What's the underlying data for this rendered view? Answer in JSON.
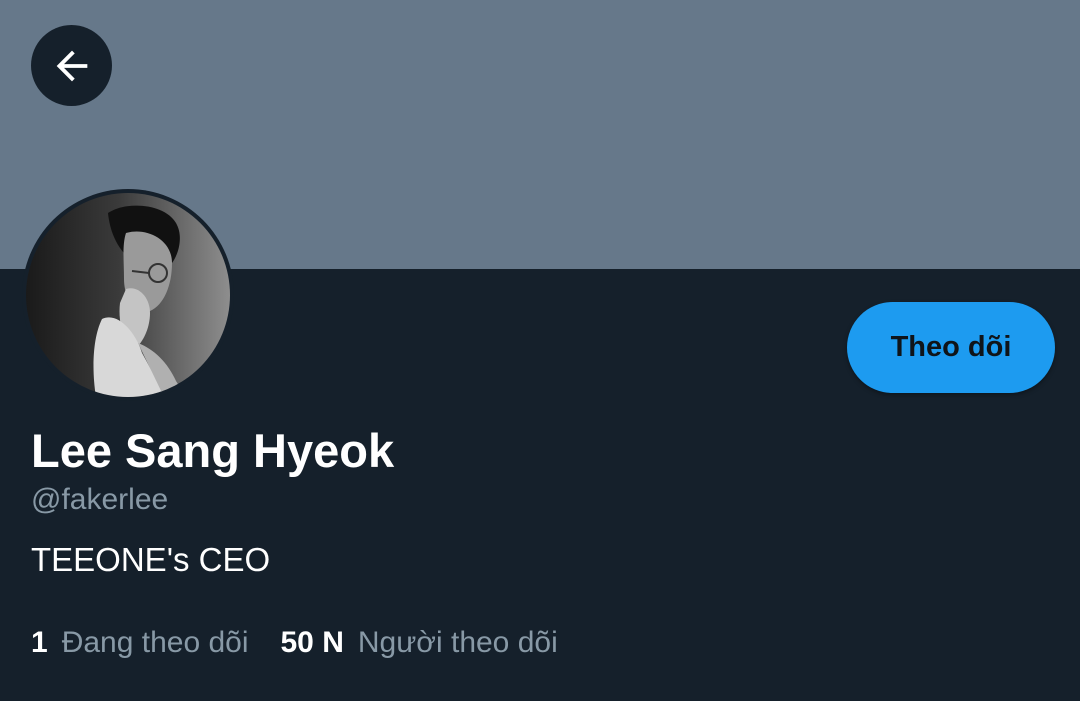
{
  "profile": {
    "display_name": "Lee Sang Hyeok",
    "handle": "@fakerlee",
    "bio": "TEEONE's CEO",
    "follow_label": "Theo dõi",
    "following_count": "1",
    "following_label": "Đang theo dõi",
    "followers_count": "50 N",
    "followers_label": "Người theo dõi"
  },
  "icons": {
    "back": "arrow-left-icon",
    "avatar": "profile-photo"
  },
  "colors": {
    "background": "#15202b",
    "banner": "#66788a",
    "accent": "#1d9bf0",
    "secondary_text": "#8899a6",
    "primary_text": "#ffffff"
  }
}
